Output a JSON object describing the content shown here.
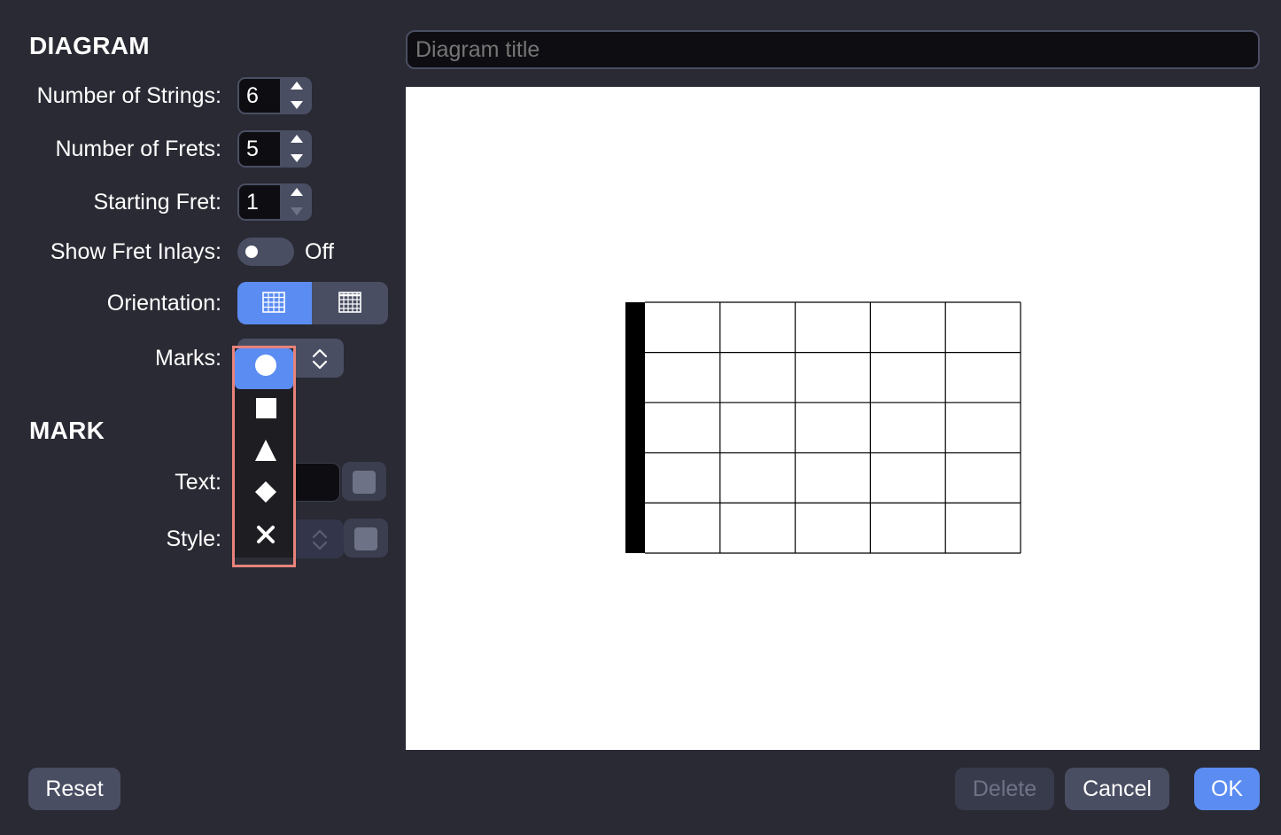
{
  "diagram": {
    "heading": "DIAGRAM",
    "strings_label": "Number of Strings:",
    "strings_value": "6",
    "frets_label": "Number of Frets:",
    "frets_value": "5",
    "start_fret_label": "Starting Fret:",
    "start_fret_value": "1",
    "inlays_label": "Show Fret Inlays:",
    "inlays_state": "Off",
    "orientation_label": "Orientation:",
    "marks_label": "Marks:"
  },
  "marks_menu": {
    "options": [
      "circle",
      "square",
      "triangle",
      "diamond",
      "x"
    ],
    "selected": "circle"
  },
  "mark": {
    "heading": "MARK",
    "text_label": "Text:",
    "style_label": "Style:"
  },
  "title_field": {
    "placeholder": "Diagram title",
    "value": ""
  },
  "fretboard": {
    "strings": 6,
    "frets": 5
  },
  "buttons": {
    "reset": "Reset",
    "delete": "Delete",
    "cancel": "Cancel",
    "ok": "OK"
  },
  "colors": {
    "background": "#2a2a34",
    "accent": "#5b8cf2",
    "control": "#4a4e63",
    "highlight": "#e8837b"
  }
}
